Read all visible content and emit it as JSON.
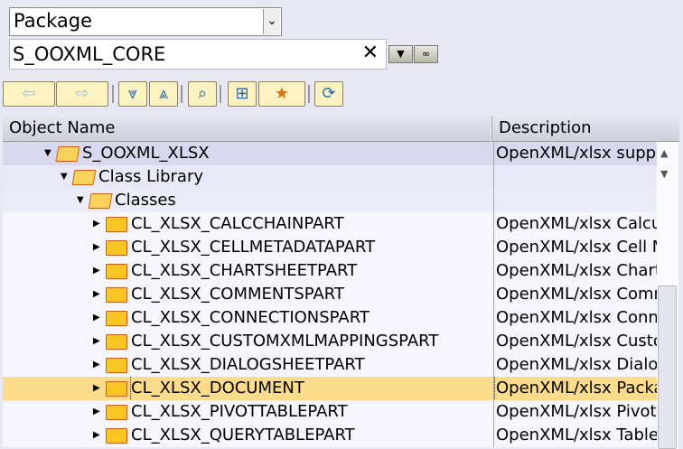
{
  "search": {
    "type": "Package",
    "value": "S_OOXML_CORE",
    "clear": "✕"
  },
  "toolbar": [
    {
      "name": "back-button",
      "glyph": "⇦",
      "dis": true
    },
    {
      "name": "forward-button",
      "glyph": "⇨",
      "dis": true
    },
    {
      "name": "expand-all-button",
      "glyph": "⩔"
    },
    {
      "name": "collapse-all-button",
      "glyph": "⩓"
    },
    {
      "name": "find-button",
      "glyph": "⌕"
    },
    {
      "name": "hierarchy-button",
      "glyph": "⊞"
    },
    {
      "name": "favorites-button",
      "glyph": "★"
    },
    {
      "name": "refresh-button",
      "glyph": "⟳"
    }
  ],
  "columns": {
    "name": "Object Name",
    "description": "Description"
  },
  "rows": [
    {
      "name": "S_OOXML_XLSX",
      "desc": "OpenXML/xlsx support",
      "level": 0,
      "open": true
    },
    {
      "name": "Class Library",
      "desc": "",
      "level": 1,
      "open": true
    },
    {
      "name": "Classes",
      "desc": "",
      "level": 2,
      "open": true
    },
    {
      "name": "CL_XLSX_CALCCHAINPART",
      "desc": "OpenXML/xlsx Calculation",
      "level": 3
    },
    {
      "name": "CL_XLSX_CELLMETADATAPART",
      "desc": "OpenXML/xlsx Cell Metadata",
      "level": 3
    },
    {
      "name": "CL_XLSX_CHARTSHEETPART",
      "desc": "OpenXML/xlsx Chartsheet",
      "level": 3
    },
    {
      "name": "CL_XLSX_COMMENTSPART",
      "desc": "OpenXML/xlsx Comments",
      "level": 3
    },
    {
      "name": "CL_XLSX_CONNECTIONSPART",
      "desc": "OpenXML/xlsx Connections",
      "level": 3
    },
    {
      "name": "CL_XLSX_CUSTOMXMLMAPPINGSPART",
      "desc": "OpenXML/xlsx Custom",
      "level": 3
    },
    {
      "name": "CL_XLSX_DIALOGSHEETPART",
      "desc": "OpenXML/xlsx Dialogsheet",
      "level": 3
    },
    {
      "name": "CL_XLSX_DOCUMENT",
      "desc": "OpenXML/xlsx Package",
      "level": 3,
      "selected": true
    },
    {
      "name": "CL_XLSX_PIVOTTABLEPART",
      "desc": "OpenXML/xlsx Pivot",
      "level": 3
    },
    {
      "name": "CL_XLSX_QUERYTABLEPART",
      "desc": "OpenXML/xlsx Table",
      "level": 3
    }
  ]
}
